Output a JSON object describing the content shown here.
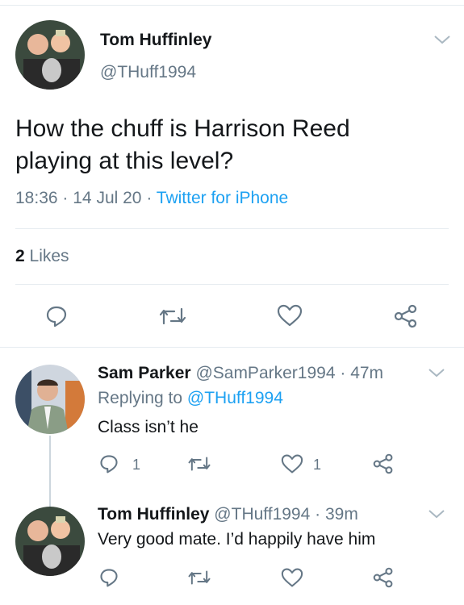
{
  "main_tweet": {
    "author_name": "Tom Huffinley",
    "author_handle": "@THuff1994",
    "text_line1": "How the chuff is Harrison Reed",
    "text_line2": "playing at this level?",
    "time": "18:36",
    "date": "14 Jul 20",
    "source": "Twitter for iPhone",
    "likes_count": "2",
    "likes_label": "Likes"
  },
  "replies": [
    {
      "author_name": "Sam Parker",
      "author_handle": "@SamParker1994",
      "age": "47m",
      "replying_prefix": "Replying to",
      "replying_to": "@THuff1994",
      "text": "Class isn’t he",
      "reply_count": "1",
      "like_count": "1"
    },
    {
      "author_name": "Tom Huffinley",
      "author_handle": "@THuff1994",
      "age": "39m",
      "text": "Very good mate. I’d happily have him"
    }
  ],
  "separator": "·",
  "icons": [
    "chevron-down-icon",
    "reply-icon",
    "retweet-icon",
    "like-icon",
    "share-icon"
  ],
  "colors": {
    "link": "#1da1f2",
    "secondary_text": "#657786",
    "divider": "#e6ecf0"
  }
}
